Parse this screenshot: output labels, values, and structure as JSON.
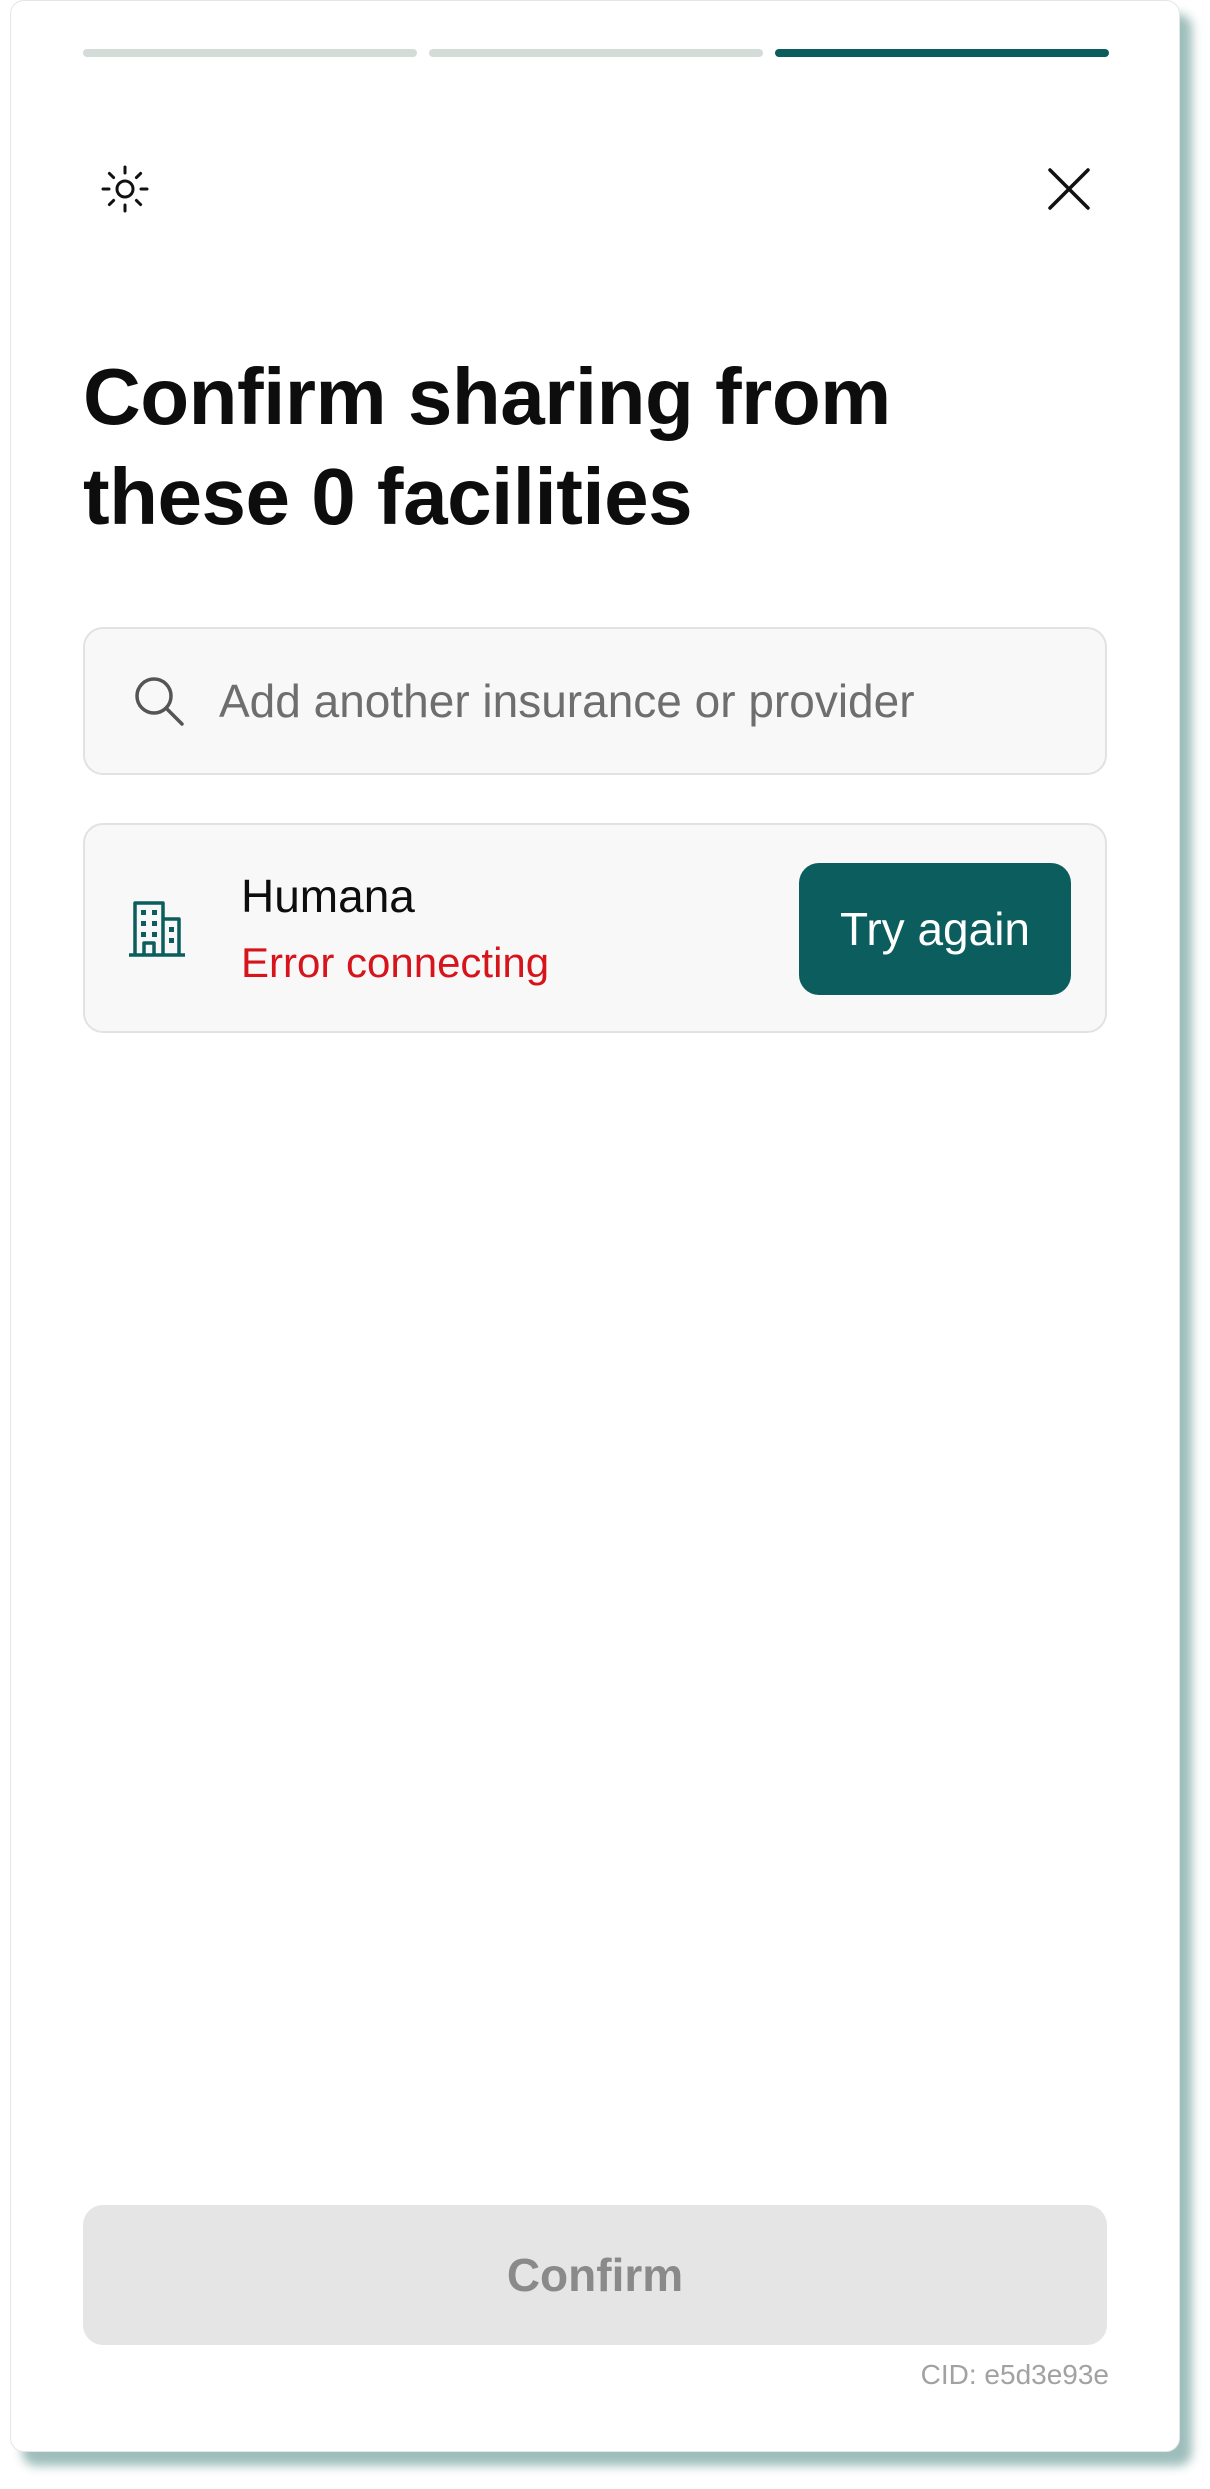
{
  "progress": {
    "total_steps": 3,
    "current_step": 3
  },
  "header": {
    "theme_icon": "sun-icon",
    "close_icon": "close-icon"
  },
  "title": {
    "line1": "Confirm sharing from",
    "line2": "these 0 facilities"
  },
  "search": {
    "icon": "search-icon",
    "placeholder": "Add another insurance or provider",
    "value": ""
  },
  "facilities": [
    {
      "icon": "building-icon",
      "name": "Humana",
      "status": "Error connecting",
      "action_label": "Try again"
    }
  ],
  "footer": {
    "confirm_label": "Confirm",
    "cid": "CID: e5d3e93e"
  },
  "colors": {
    "accent": "#0b5d5e",
    "error": "#d6141b",
    "progress_inactive": "#d3dcd6",
    "disabled_bg": "#e5e5e5"
  }
}
